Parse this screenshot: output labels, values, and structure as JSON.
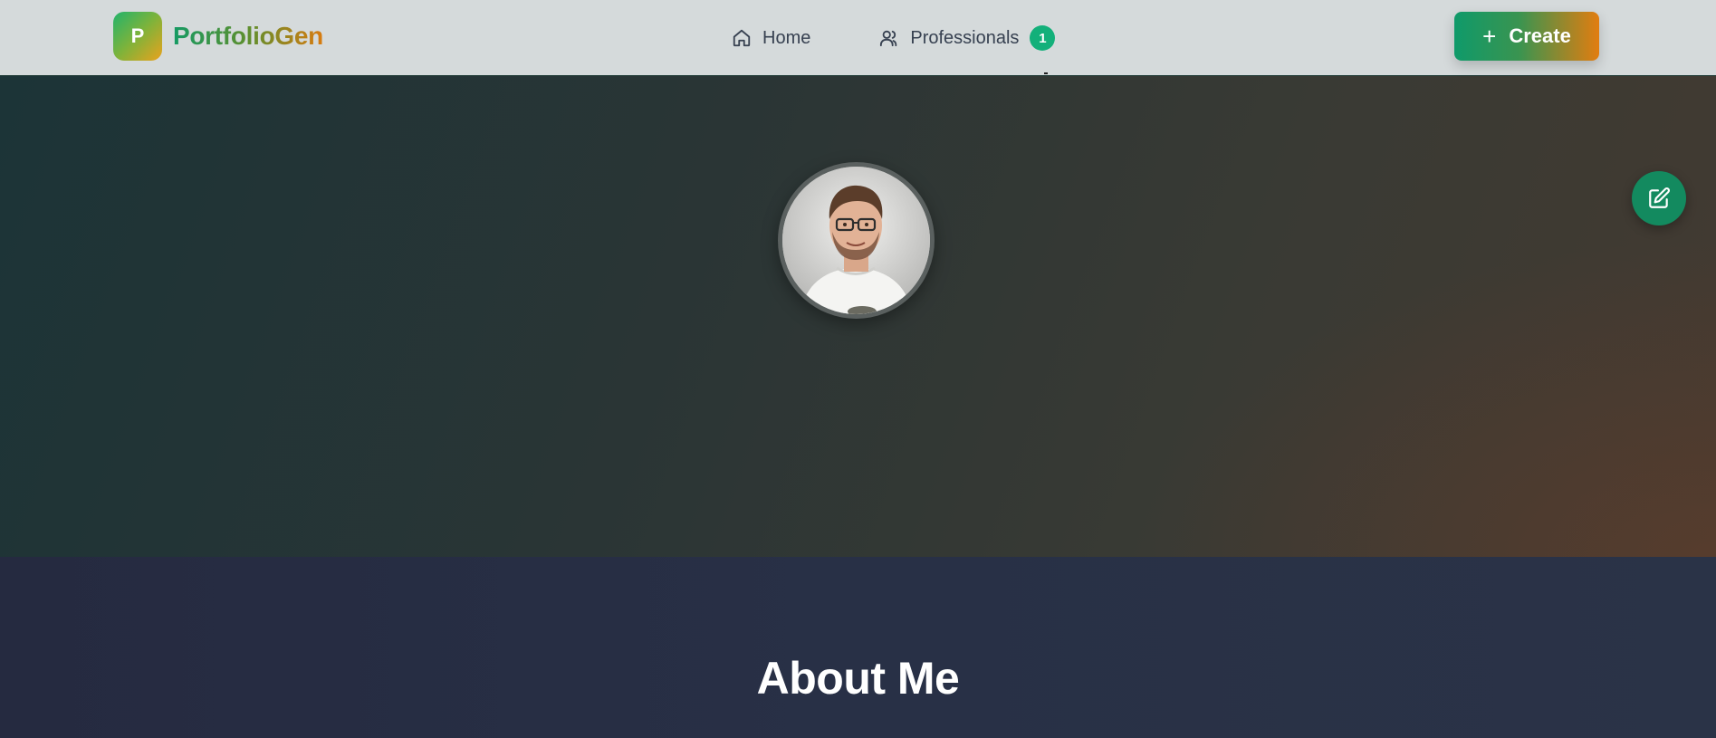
{
  "header": {
    "brand_initial": "P",
    "brand_name": "PortfolioGen",
    "nav": [
      {
        "label": "Home",
        "icon": "home-icon"
      },
      {
        "label": "Professionals",
        "icon": "users-icon",
        "badge": "1"
      }
    ],
    "create_label": "Create",
    "create_icon": "plus-icon"
  },
  "hero": {
    "avatar": "profile-photo",
    "edit_icon": "edit-icon"
  },
  "about": {
    "heading": "About Me"
  },
  "colors": {
    "accent_green": "#13b07a",
    "accent_orange": "#e27d10"
  }
}
